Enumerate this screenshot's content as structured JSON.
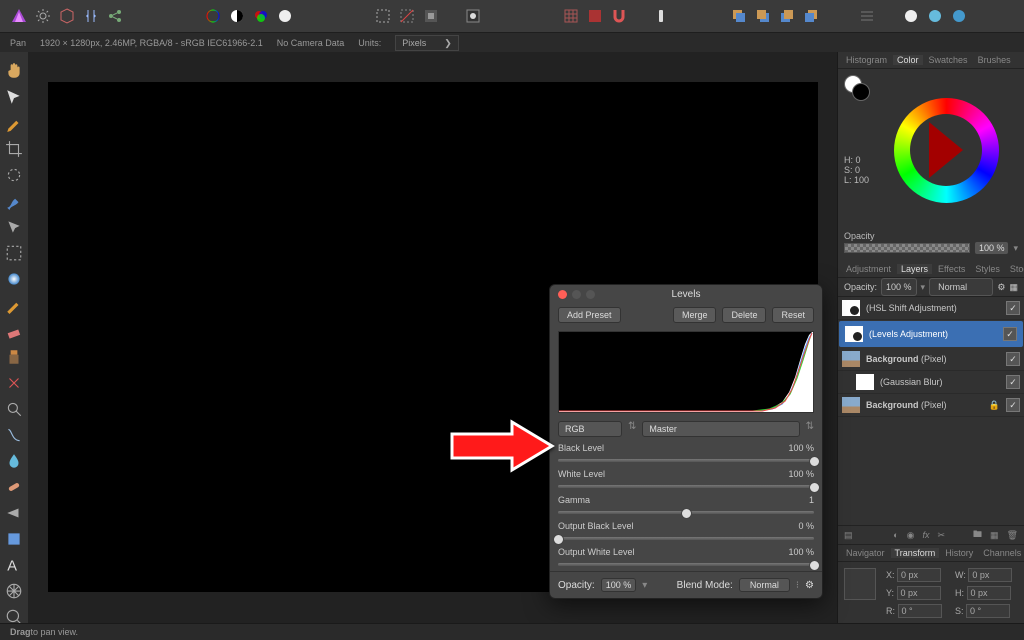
{
  "topbar": {
    "app_icon": "affinity-photo-icon"
  },
  "subbar": {
    "tool": "Pan",
    "docinfo": "1920 × 1280px, 2.46MP, RGBA/8 - sRGB IEC61966-2.1",
    "camera": "No Camera Data",
    "units_label": "Units:",
    "units_value": "Pixels"
  },
  "rpanel": {
    "tabs1": [
      "Histogram",
      "Color",
      "Swatches",
      "Brushes"
    ],
    "tabs1_active": "Color",
    "hsl": {
      "h_label": "H:",
      "h": "0",
      "s_label": "S:",
      "s": "0",
      "l_label": "L:",
      "l": "100"
    },
    "opacity_label": "Opacity",
    "opacity_value": "100 %",
    "tabs2": [
      "Adjustment",
      "Layers",
      "Effects",
      "Styles",
      "Stock"
    ],
    "tabs2_active": "Layers",
    "layer_opacity_label": "Opacity:",
    "layer_opacity": "100 %",
    "blend_mode": "Normal",
    "layers": [
      {
        "name": "(HSL Shift Adjustment)",
        "type": "adj",
        "sel": false,
        "checked": true
      },
      {
        "name": "(Levels Adjustment)",
        "type": "adj",
        "sel": true,
        "checked": true
      },
      {
        "name": "Background (Pixel)",
        "type": "img",
        "sel": false,
        "checked": true,
        "bold": true
      },
      {
        "name": "(Gaussian Blur)",
        "type": "mask",
        "sel": false,
        "checked": true,
        "indent": true
      },
      {
        "name": "Background (Pixel)",
        "type": "img",
        "sel": false,
        "checked": true,
        "locked": true,
        "bold": true
      }
    ],
    "tabs3": [
      "Navigator",
      "Transform",
      "History",
      "Channels"
    ],
    "tabs3_active": "Transform",
    "transform": {
      "x_label": "X:",
      "x": "0 px",
      "y_label": "Y:",
      "y": "0 px",
      "w_label": "W:",
      "w": "0 px",
      "h_label": "H:",
      "h": "0 px",
      "r_label": "R:",
      "r": "0 °",
      "s_label": "S:",
      "s": "0 °"
    }
  },
  "dialog": {
    "title": "Levels",
    "add_preset": "Add Preset",
    "merge": "Merge",
    "delete": "Delete",
    "reset": "Reset",
    "space": "RGB",
    "channel": "Master",
    "params": [
      {
        "label": "Black Level",
        "value": "100 %",
        "thumb": 1.0
      },
      {
        "label": "White Level",
        "value": "100 %",
        "thumb": 1.0
      },
      {
        "label": "Gamma",
        "value": "1",
        "thumb": 0.5
      },
      {
        "label": "Output Black Level",
        "value": "0 %",
        "thumb": 0.0
      },
      {
        "label": "Output White Level",
        "value": "100 %",
        "thumb": 1.0
      }
    ],
    "foot_opacity_label": "Opacity:",
    "foot_opacity": "100 %",
    "foot_blend_label": "Blend Mode:",
    "foot_blend": "Normal"
  },
  "statusbar": {
    "hint_strong": "Drag",
    "hint_rest": " to pan view."
  }
}
